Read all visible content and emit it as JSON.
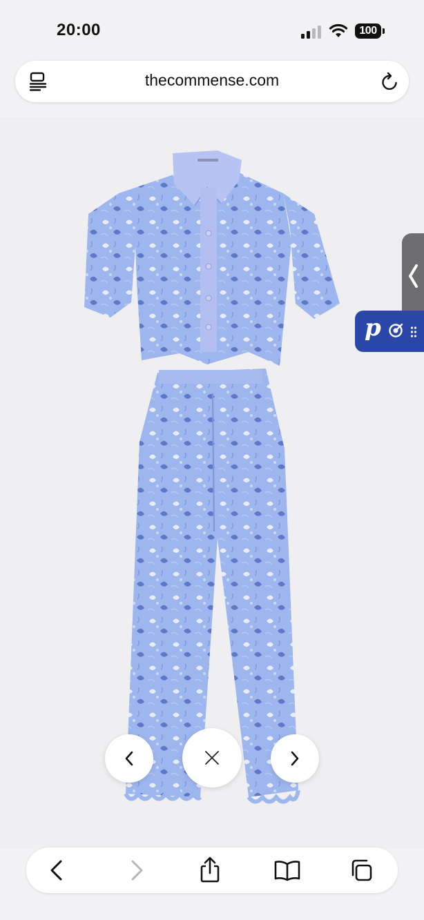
{
  "status_bar": {
    "time": "20:00",
    "battery": "100",
    "icons": [
      "cellular-signal-icon",
      "wifi-icon",
      "battery-icon"
    ]
  },
  "browser": {
    "url": "thecommense.com",
    "icons": [
      "reader-view-icon",
      "reload-icon"
    ]
  },
  "gallery": {
    "image_description_icon": "product-image",
    "controls": [
      "previous-image-icon",
      "close-icon",
      "next-image-icon"
    ]
  },
  "side_widgets": {
    "tab_icon": "chevron-left-icon",
    "pin_letter": "p",
    "pin_icons": [
      "target-icon",
      "drag-handle-icon"
    ],
    "pin_color": "#2a46a8"
  },
  "toolbar": {
    "items": [
      "back-icon",
      "forward-icon",
      "share-icon",
      "bookmarks-icon",
      "tabs-icon"
    ]
  },
  "colors": {
    "garment": "#9db6ee",
    "garment_shadow": "#6f8ddd",
    "background": "#efeff1"
  }
}
